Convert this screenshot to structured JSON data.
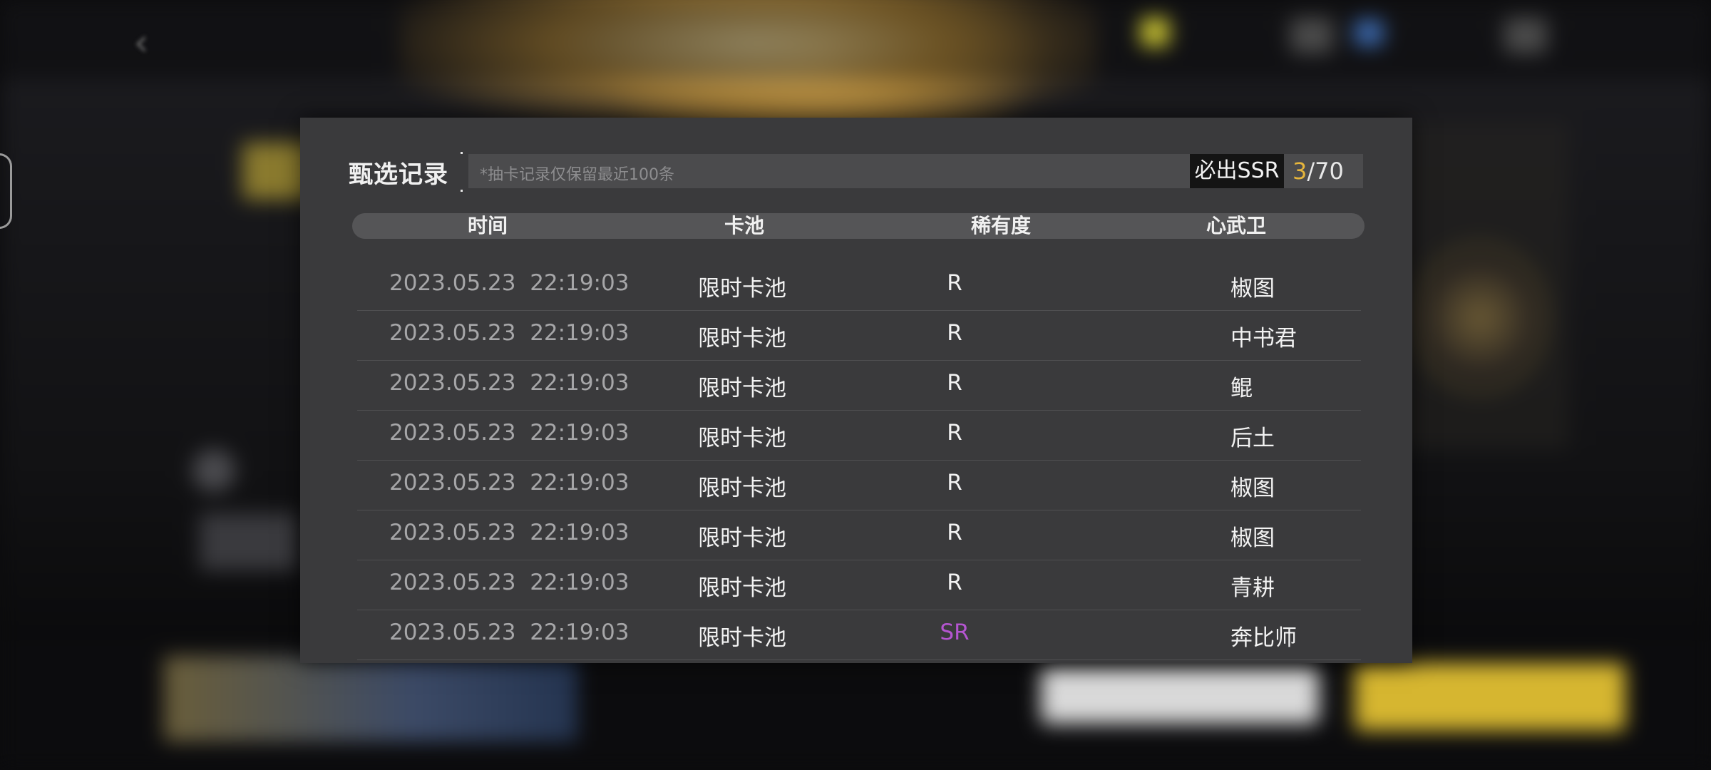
{
  "modal": {
    "title": "甄选记录",
    "notice": "*抽卡记录仅保留最近100条",
    "pity_label": "必出SSR",
    "pity_current": "3",
    "pity_total": "/70"
  },
  "table": {
    "headers": {
      "time": "时间",
      "pool": "卡池",
      "rarity": "稀有度",
      "weapon": "心武卫"
    },
    "rows": [
      {
        "time": "2023.05.23  22:19:03",
        "pool": "限时卡池",
        "rarity": "R",
        "weapon": "椒图"
      },
      {
        "time": "2023.05.23  22:19:03",
        "pool": "限时卡池",
        "rarity": "R",
        "weapon": "中书君"
      },
      {
        "time": "2023.05.23  22:19:03",
        "pool": "限时卡池",
        "rarity": "R",
        "weapon": "鲲"
      },
      {
        "time": "2023.05.23  22:19:03",
        "pool": "限时卡池",
        "rarity": "R",
        "weapon": "后土"
      },
      {
        "time": "2023.05.23  22:19:03",
        "pool": "限时卡池",
        "rarity": "R",
        "weapon": "椒图"
      },
      {
        "time": "2023.05.23  22:19:03",
        "pool": "限时卡池",
        "rarity": "R",
        "weapon": "椒图"
      },
      {
        "time": "2023.05.23  22:19:03",
        "pool": "限时卡池",
        "rarity": "R",
        "weapon": "青耕"
      },
      {
        "time": "2023.05.23  22:19:03",
        "pool": "限时卡池",
        "rarity": "SR",
        "weapon": "奔比师"
      }
    ]
  },
  "colors": {
    "pity_current": "#e6b53c",
    "rarity_sr": "#b455d0",
    "modal_bg": "#3a3a3c"
  },
  "icons": {
    "back": "back-arrow-icon",
    "side": "hexagon-icon"
  }
}
